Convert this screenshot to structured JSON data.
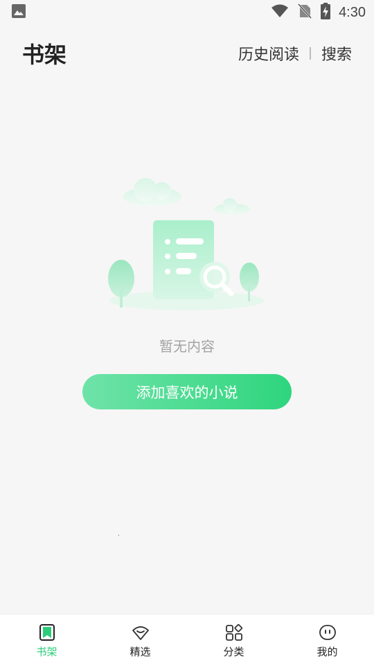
{
  "status_bar": {
    "time": "4:30",
    "icons": [
      "image-icon",
      "wifi-icon",
      "no-sim-icon",
      "battery-charging-icon"
    ]
  },
  "header": {
    "title": "书架",
    "history_label": "历史阅读",
    "search_label": "搜索"
  },
  "empty_state": {
    "illustration_icon": "empty-document-search-illustration",
    "message": "暂无内容",
    "button_label": "添加喜欢的小说"
  },
  "bottom_nav": {
    "items": [
      {
        "label": "书架",
        "icon": "bookshelf-icon",
        "active": true
      },
      {
        "label": "精选",
        "icon": "selected-icon",
        "active": false
      },
      {
        "label": "分类",
        "icon": "category-icon",
        "active": false
      },
      {
        "label": "我的",
        "icon": "profile-icon",
        "active": false
      }
    ]
  },
  "colors": {
    "accent": "#2ed57e",
    "accent_light": "#6fe3a8",
    "background": "#f6f6f6",
    "nav_background": "#ffffff",
    "text_primary": "#222222",
    "text_muted": "#a3a3a3"
  }
}
